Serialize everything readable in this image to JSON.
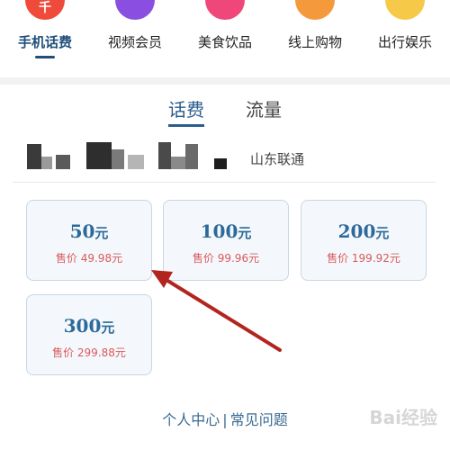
{
  "categories": [
    {
      "label": "手机话费",
      "icon": "phone-bill-icon",
      "color": "#f04a3a",
      "glyph": "千",
      "active": true
    },
    {
      "label": "视频会员",
      "icon": "video-icon",
      "color": "#8a4fe0",
      "glyph": "",
      "active": false
    },
    {
      "label": "美食饮品",
      "icon": "food-icon",
      "color": "#f0477a",
      "glyph": "",
      "active": false
    },
    {
      "label": "线上购物",
      "icon": "shopping-icon",
      "color": "#f59a3c",
      "glyph": "",
      "active": false
    },
    {
      "label": "出行娱乐",
      "icon": "travel-icon",
      "color": "#f7c948",
      "glyph": "",
      "active": false
    }
  ],
  "tabs": {
    "active": "话费",
    "inactive": "流量"
  },
  "account": {
    "carrier": "山东联通"
  },
  "cards": [
    {
      "amount": "50",
      "unit": "元",
      "price": "售价 49.98元"
    },
    {
      "amount": "100",
      "unit": "元",
      "price": "售价 99.96元"
    },
    {
      "amount": "200",
      "unit": "元",
      "price": "售价 199.92元"
    },
    {
      "amount": "300",
      "unit": "元",
      "price": "售价 299.88元"
    }
  ],
  "footer": {
    "personal": "个人中心",
    "separator": "|",
    "faq": "常见问题"
  },
  "watermark": "Bai经验",
  "colors": {
    "accent": "#2b5d8c",
    "price": "#d95a5a",
    "arrow": "#b2251f"
  }
}
